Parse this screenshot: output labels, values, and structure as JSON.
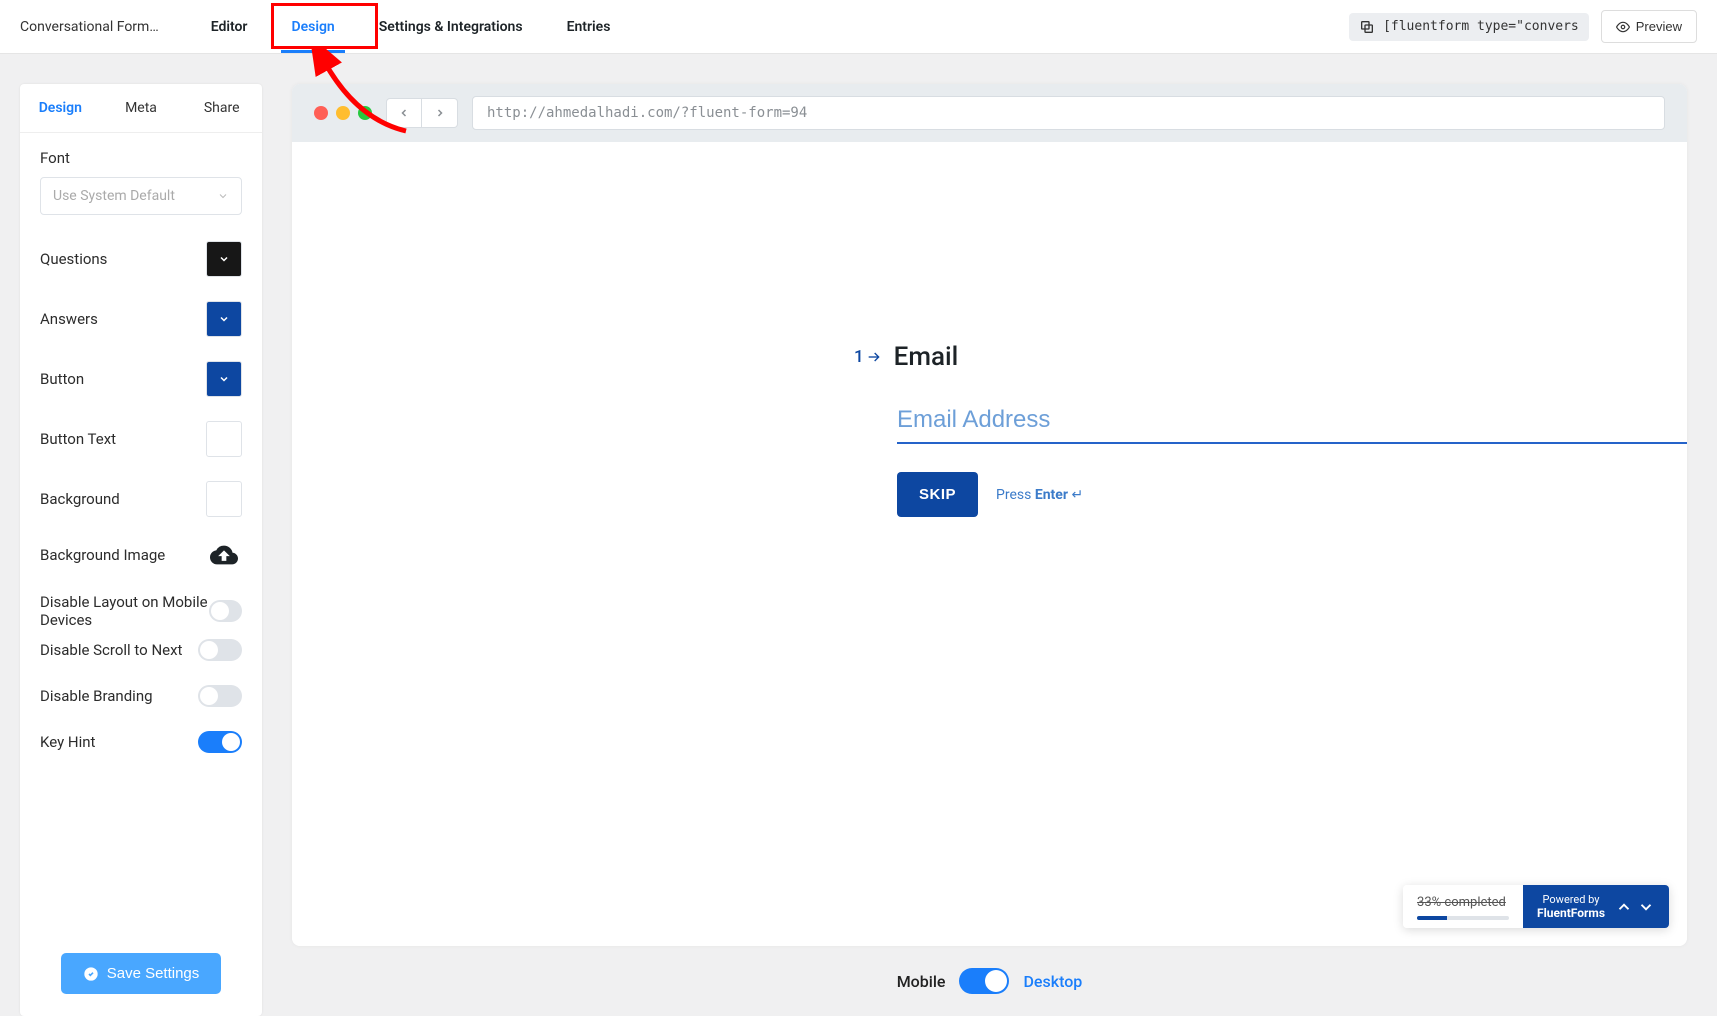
{
  "topbar": {
    "title": "Conversational Form…",
    "tabs": [
      "Editor",
      "Design",
      "Settings & Integrations",
      "Entries"
    ],
    "active_tab": 1,
    "shortcode": "[fluentform type=\"convers",
    "preview_label": "Preview"
  },
  "sidebar": {
    "tabs": [
      "Design",
      "Meta",
      "Share"
    ],
    "active_tab": 0,
    "font_label": "Font",
    "font_placeholder": "Use System Default",
    "rows": {
      "questions": "Questions",
      "answers": "Answers",
      "button": "Button",
      "button_text": "Button Text",
      "background": "Background",
      "background_image": "Background Image",
      "disable_layout_mobile": "Disable Layout on Mobile Devices",
      "disable_scroll": "Disable Scroll to Next",
      "disable_branding": "Disable Branding",
      "key_hint": "Key Hint"
    },
    "colors": {
      "questions": "#171717",
      "answers": "#0d47a1",
      "button": "#0d47a1",
      "button_text": "#ffffff",
      "background": "#ffffff"
    },
    "toggles": {
      "disable_layout_mobile": false,
      "disable_scroll": false,
      "disable_branding": false,
      "key_hint": true
    },
    "save_label": "Save Settings"
  },
  "browser": {
    "url": "http://ahmedalhadi.com/?fluent-form=94"
  },
  "form": {
    "question_number": "1",
    "question_title": "Email",
    "input_placeholder": "Email Address",
    "skip_label": "SKIP",
    "hint_prefix": "Press ",
    "hint_key": "Enter",
    "hint_glyph": "↵"
  },
  "progress": {
    "percent_label": "33% completed",
    "percent_value": 33,
    "powered_by_prefix": "Powered by",
    "powered_by_brand": "FluentForms"
  },
  "device_toggle": {
    "mobile": "Mobile",
    "desktop": "Desktop"
  }
}
